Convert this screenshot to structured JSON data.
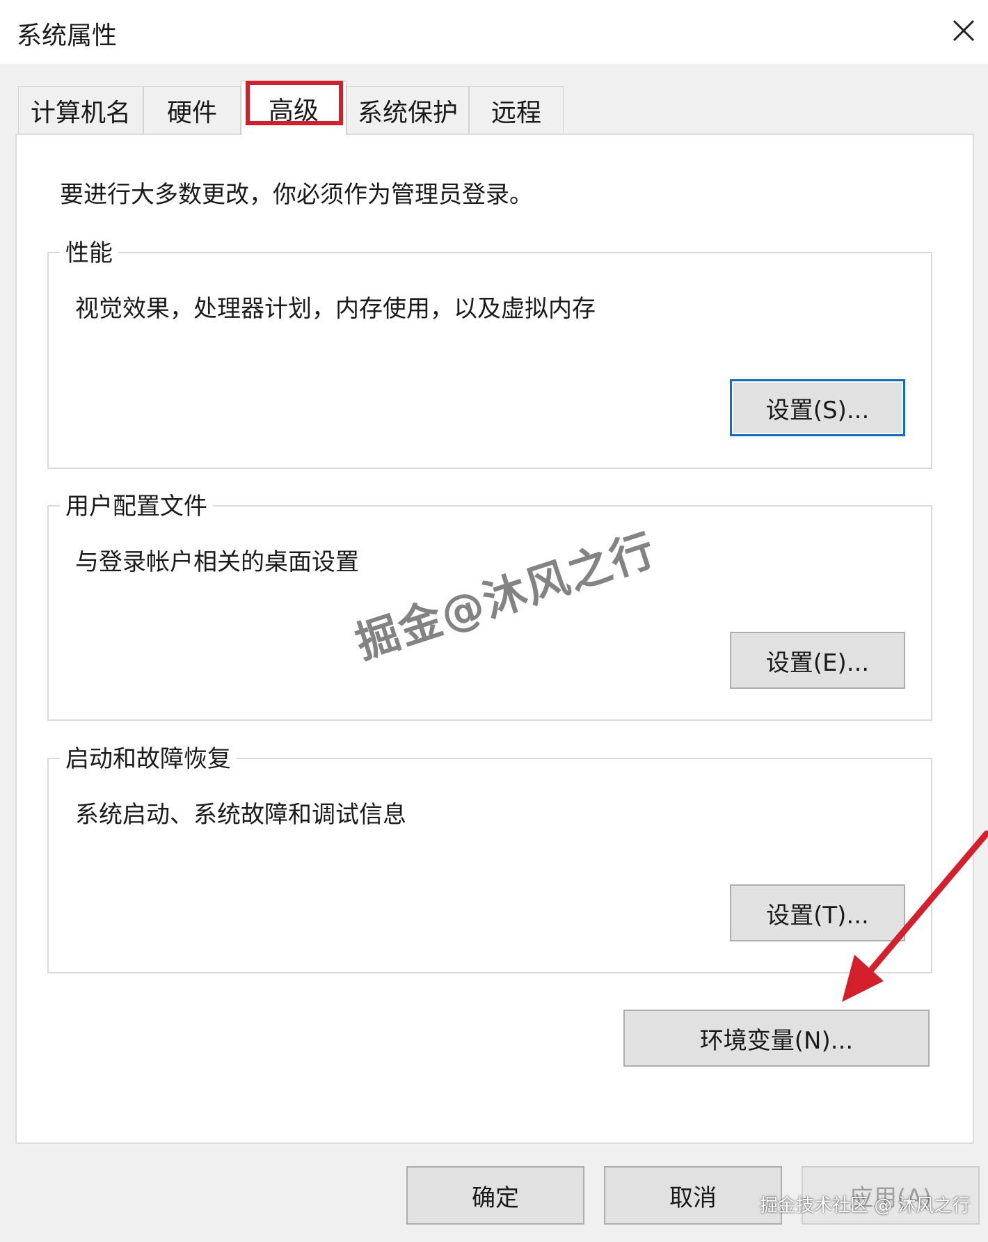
{
  "window": {
    "title": "系统属性"
  },
  "tabs": [
    {
      "label": "计算机名"
    },
    {
      "label": "硬件"
    },
    {
      "label": "高级",
      "active": true
    },
    {
      "label": "系统保护"
    },
    {
      "label": "远程"
    }
  ],
  "notice": "要进行大多数更改，你必须作为管理员登录。",
  "groups": {
    "performance": {
      "legend": "性能",
      "description": "视觉效果，处理器计划，内存使用，以及虚拟内存",
      "button": "设置(S)..."
    },
    "user_profiles": {
      "legend": "用户配置文件",
      "description": "与登录帐户相关的桌面设置",
      "button": "设置(E)..."
    },
    "startup_recovery": {
      "legend": "启动和故障恢复",
      "description": "系统启动、系统故障和调试信息",
      "button": "设置(T)..."
    }
  },
  "env_button": "环境变量(N)...",
  "footer": {
    "ok": "确定",
    "cancel": "取消",
    "apply": "应用(A)"
  },
  "watermarks": {
    "center": "掘金@沐风之行",
    "corner": "掘金技术社区 @ 沐风之行"
  },
  "colors": {
    "highlight_box": "#d4202c",
    "focus_border": "#0a6ed1",
    "arrow": "#d4202c"
  }
}
